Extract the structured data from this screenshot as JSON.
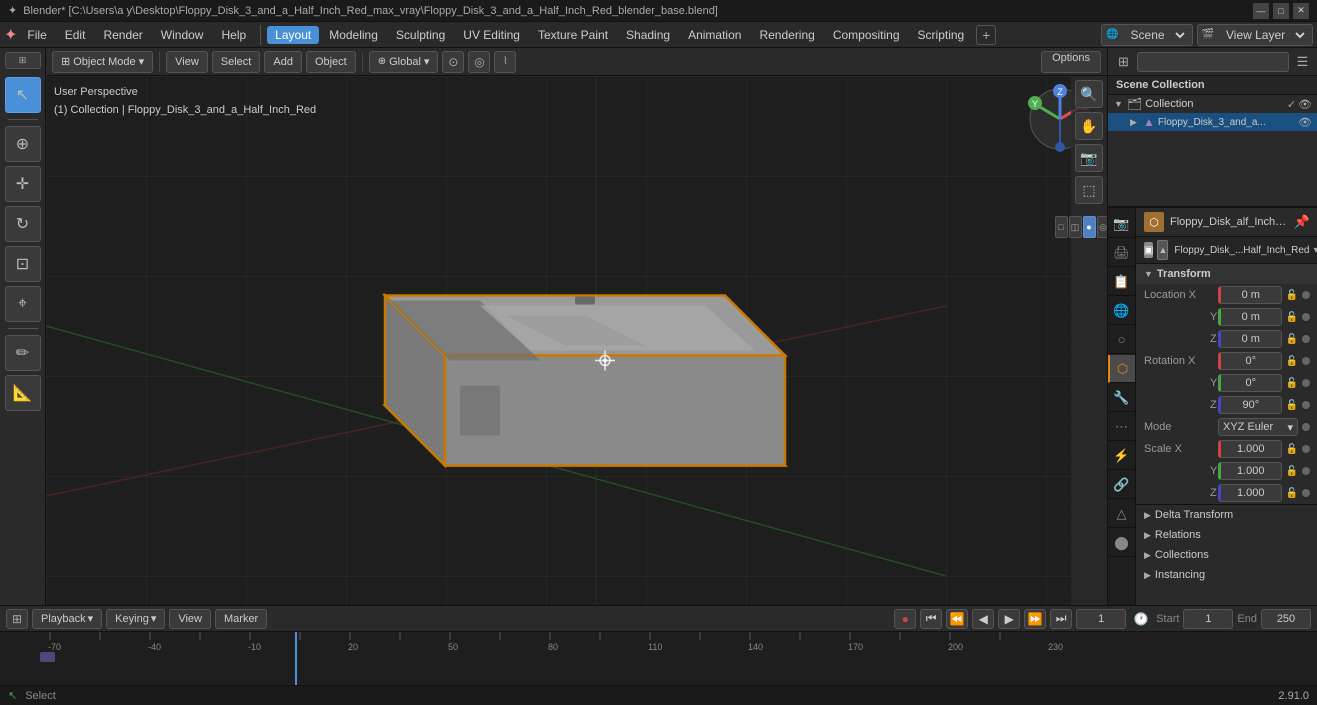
{
  "title_bar": {
    "title": "Blender* [C:\\Users\\a y\\Desktop\\Floppy_Disk_3_and_a_Half_Inch_Red_max_vray\\Floppy_Disk_3_and_a_Half_Inch_Red_blender_base.blend]",
    "minimize": "—",
    "maximize": "□",
    "close": "✕"
  },
  "menu": {
    "blender_icon": "✦",
    "items": [
      "File",
      "Edit",
      "Render",
      "Window",
      "Help"
    ],
    "tabs": [
      "Layout",
      "Modeling",
      "Sculpting",
      "UV Editing",
      "Texture Paint",
      "Shading",
      "Animation",
      "Rendering",
      "Compositing",
      "Scripting"
    ],
    "active_tab": "Layout",
    "add_btn": "+",
    "scene": "Scene",
    "view_layer": "View Layer"
  },
  "viewport": {
    "mode": "Object Mode",
    "view_menu": "View",
    "select_menu": "Select",
    "add_menu": "Add",
    "object_menu": "Object",
    "transform": "Global",
    "snap_icon": "⊙",
    "proportional_icon": "◎",
    "options_btn": "Options",
    "info_line1": "User Perspective",
    "info_line2": "(1) Collection | Floppy_Disk_3_and_a_Half_Inch_Red"
  },
  "outliner": {
    "search_placeholder": "",
    "scene_collection": "Scene Collection",
    "collection": "Collection",
    "floppy_item": "Floppy_Disk_3_and_a...",
    "floppy_full": "Floppy_Disk_3_and_a_Half_Inch_Red"
  },
  "properties": {
    "obj_name": "Floppy_Disk_alf_Inch_Red",
    "obj_name2": "Floppy_Disk_...Half_Inch_Red",
    "transform_section": "Transform",
    "location_x": "0 m",
    "location_y": "0 m",
    "location_z": "0 m",
    "rotation_x": "0°",
    "rotation_y": "0°",
    "rotation_z": "90°",
    "mode_label": "Mode",
    "mode_value": "XYZ Euler",
    "scale_x": "1.000",
    "scale_y": "1.000",
    "scale_z": "1.000",
    "delta_transform": "Delta Transform",
    "relations": "Relations",
    "collections": "Collections",
    "instancing": "Instancing"
  },
  "timeline": {
    "playback_btn": "Playback",
    "keying_btn": "Keying",
    "view_btn": "View",
    "marker_btn": "Marker",
    "record_btn": "●",
    "jump_start_btn": "⏮",
    "step_back_btn": "⏪",
    "play_back_btn": "◀",
    "play_btn": "▶",
    "step_fwd_btn": "⏩",
    "jump_end_btn": "⏭",
    "current_frame": "1",
    "start_frame": "1",
    "end_frame": "250",
    "start_label": "Start",
    "end_label": "End"
  },
  "status": {
    "select": "Select",
    "version": "2.91.0"
  }
}
